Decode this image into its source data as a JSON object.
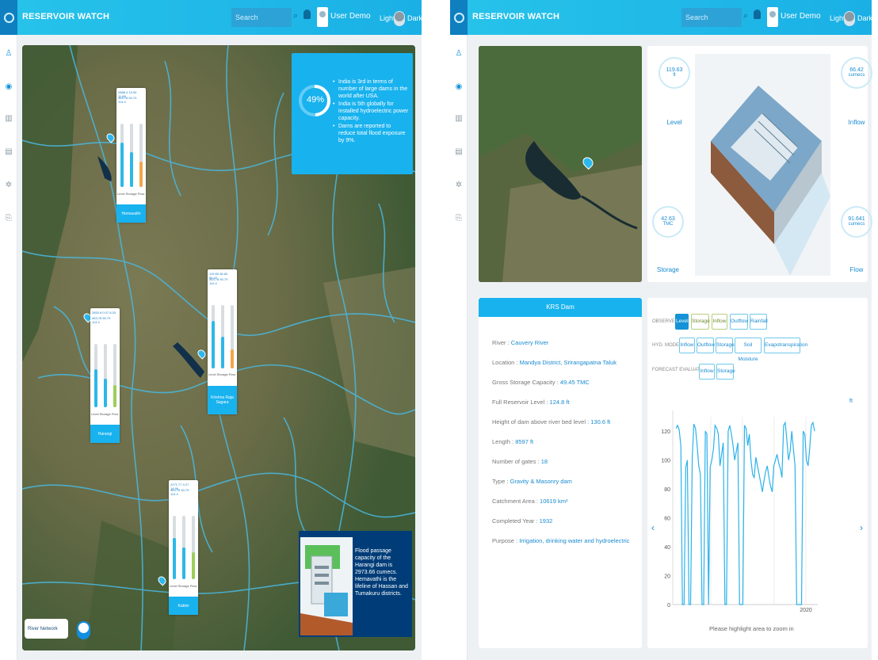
{
  "app": {
    "title": "RESERVOIR WATCH",
    "search_placeholder": "Search",
    "user": "User Demo",
    "theme_light": "Light",
    "theme_dark": "Dark",
    "sidebar_icons": [
      "person-icon",
      "circle-icon",
      "building-icon",
      "image-icon",
      "gear-icon",
      "exit-icon"
    ]
  },
  "left": {
    "info": {
      "percent": "49%",
      "percent_value": 49,
      "bullets": [
        "India is 3rd in terms of number of large dams in the world after USA.",
        "India is 5th globally for installed hydroelectric power capacity.",
        "Dams are reported to reduce total flood exposure by 9%."
      ]
    },
    "cards": [
      {
        "name": "Hemavathi",
        "vals": "2888.4  15.59  11.88",
        "vals2": "463.78  50.79  114.4"
      },
      {
        "name": "Harangi",
        "vals": "2853 ft  0.07  8.03",
        "vals2": "463.78  50.79  114.4"
      },
      {
        "name": "Krishna Raja Sagara",
        "vals": "119.85  48.83  66.42",
        "vals2": "463.78  50.79  114.4"
      },
      {
        "name": "Kabini",
        "vals": "2271.77  0.27  14.96",
        "vals2": "463.78  50.79  114.4"
      }
    ],
    "legend": "Level  Storage  Flow",
    "fact": "Flood passage capacity of the Harangi dam is 2973.66 cumecs. Hemavathi is the lifeline of Hassan and Tumakuru districts.",
    "river_network": "River Network"
  },
  "right": {
    "stats": {
      "level_value": "119.63",
      "level_unit": "ft",
      "level_label": "Level",
      "inflow_value": "66.42",
      "inflow_unit": "cumecs",
      "inflow_label": "Inflow",
      "storage_value": "42.63",
      "storage_unit": "TMC",
      "storage_label": "Storage",
      "flow_value": "91.641",
      "flow_unit": "cumecs",
      "flow_label": "Flow"
    },
    "detail": {
      "title": "KRS Dam",
      "rows": [
        {
          "k": "River : ",
          "v": "Cauvery River"
        },
        {
          "k": "Location : ",
          "v": "Mandya District, Srirangapatna Taluk"
        },
        {
          "k": "Gross Storage Capacity : ",
          "v": "49.45 TMC"
        },
        {
          "k": "Full Reservoir Level : ",
          "v": "124.8 ft"
        },
        {
          "k": "Height of dam above river bed level : ",
          "v": "130.6 ft"
        },
        {
          "k": "Length : ",
          "v": "8597 ft"
        },
        {
          "k": "Number of gates : ",
          "v": "18"
        },
        {
          "k": "Type : ",
          "v": "Gravity & Masonry dam"
        },
        {
          "k": "Catchment Area : ",
          "v": "10619 km²"
        },
        {
          "k": "Completed Year : ",
          "v": "1932"
        },
        {
          "k": "Purpose : ",
          "v": "Irrigation, drinking water and hydroelectric"
        }
      ]
    },
    "filters": {
      "observed_label": "OBSERVED",
      "observed": [
        "Level",
        "Storage",
        "Inflow",
        "Outflow",
        "Rainfall"
      ],
      "hyd_label": "HYD. MODEL",
      "hyd": [
        "Inflow",
        "Outflow",
        "Storage",
        "Soil Moisture",
        "Evapotranspiration"
      ],
      "forecast_label": "FORECAST EVALUATION",
      "forecast": [
        "Inflow",
        "Storage"
      ]
    },
    "chart_hint": "Please highlight area to zoom in",
    "chart_unit": "ft"
  },
  "chart_data": {
    "type": "line",
    "ylabel": "ft",
    "yticks": [
      0,
      20,
      40,
      60,
      80,
      100,
      120
    ],
    "ylim": [
      0,
      130
    ],
    "xticks": [
      "2020"
    ],
    "series": [
      {
        "values": [
          122,
          124,
          121,
          110,
          0,
          0,
          95,
          100,
          0,
          0,
          102,
          125,
          122,
          110,
          96,
          90,
          0,
          0,
          120,
          118,
          0,
          95,
          100,
          108,
          124,
          122,
          118,
          96,
          104,
          112,
          0,
          0,
          120,
          124,
          118,
          110,
          100,
          106,
          112,
          0,
          0,
          0,
          124,
          122,
          110,
          118,
          100,
          90,
          88,
          102,
          96,
          90,
          84,
          78,
          86,
          92,
          96,
          88,
          82,
          78,
          96,
          100,
          104,
          98,
          94,
          88,
          124,
          126,
          114,
          100,
          106,
          120,
          108,
          96,
          0,
          0,
          0,
          0,
          120,
          118,
          100,
          96,
          108,
          124,
          126,
          120
        ]
      }
    ]
  }
}
